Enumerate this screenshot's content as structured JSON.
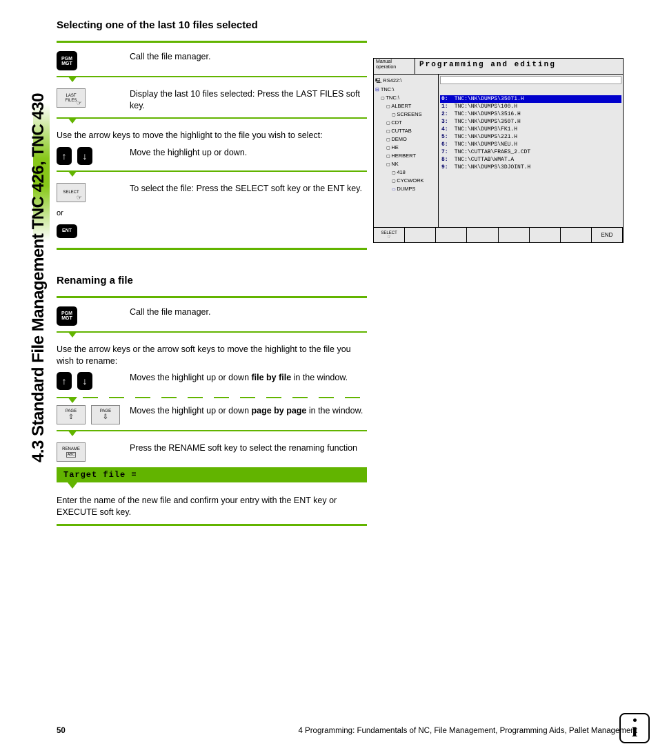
{
  "sideTitle": "4.3 Standard File Management TNC 426, TNC 430",
  "section1": {
    "heading": "Selecting one of the last 10 files selected",
    "step1": {
      "desc": "Call the file manager."
    },
    "step2": {
      "desc": "Display the last 10 files selected: Press the LAST FILES soft key."
    },
    "intro": "Use the arrow keys to move the highlight to the file you wish to select:",
    "step3": {
      "desc": "Move the highlight up or down."
    },
    "step4": {
      "desc": "To select the file: Press the SELECT soft key or the ENT key."
    },
    "or": "or"
  },
  "section2": {
    "heading": "Renaming a file",
    "step1": {
      "desc": "Call the file manager."
    },
    "intro": "Use the arrow keys or the arrow soft keys to move the highlight to the file you wish to rename:",
    "step2": {
      "pre": "Moves the highlight up or down ",
      "bold": "file by file",
      "post": " in the window."
    },
    "step3": {
      "pre": "Moves the highlight up or down ",
      "bold": "page by page",
      "post": " in the window."
    },
    "step4": {
      "desc": "Press the RENAME soft key to select the renaming function"
    },
    "target": "Target file =",
    "final": "Enter the name of the new file and confirm your entry with the ENT key or EXECUTE soft key."
  },
  "keys": {
    "pgm1": "PGM",
    "pgm2": "MGT",
    "lastfiles": "LAST FILES",
    "select": "SELECT",
    "ent": "ENT",
    "page": "PAGE",
    "rename": "RENAME",
    "renameSub": "ABC = XYZ"
  },
  "screenshot": {
    "mode": "Manual operation",
    "title": "Programming and editing",
    "tree": [
      {
        "cls": "disk",
        "txt": "RS422:\\",
        "ind": ""
      },
      {
        "cls": "drv",
        "txt": "TNC:\\",
        "ind": ""
      },
      {
        "cls": "fold",
        "txt": "TNC:\\",
        "ind": "ind1"
      },
      {
        "cls": "fold",
        "txt": "ALBERT",
        "ind": "ind2"
      },
      {
        "cls": "fold",
        "txt": "SCREENS",
        "ind": "ind3"
      },
      {
        "cls": "fold",
        "txt": "CDT",
        "ind": "ind2"
      },
      {
        "cls": "fold",
        "txt": "CUTTAB",
        "ind": "ind2"
      },
      {
        "cls": "fold",
        "txt": "DEMO",
        "ind": "ind2"
      },
      {
        "cls": "fold",
        "txt": "HE",
        "ind": "ind2"
      },
      {
        "cls": "fold",
        "txt": "HERBERT",
        "ind": "ind2"
      },
      {
        "cls": "fold",
        "txt": "NK",
        "ind": "ind2"
      },
      {
        "cls": "fold",
        "txt": "418",
        "ind": "ind3"
      },
      {
        "cls": "fold",
        "txt": "CYCWORK",
        "ind": "ind3"
      },
      {
        "cls": "open",
        "txt": "DUMPS",
        "ind": "ind3"
      }
    ],
    "files": [
      {
        "n": "0:",
        "t": "TNC:\\NK\\DUMPS\\35071.H",
        "sel": true
      },
      {
        "n": "1:",
        "t": "TNC:\\NK\\DUMPS\\100.H"
      },
      {
        "n": "2:",
        "t": "TNC:\\NK\\DUMPS\\3516.H"
      },
      {
        "n": "3:",
        "t": "TNC:\\NK\\DUMPS\\3507.H"
      },
      {
        "n": "4:",
        "t": "TNC:\\NK\\DUMPS\\FK1.H"
      },
      {
        "n": "5:",
        "t": "TNC:\\NK\\DUMPS\\221.H"
      },
      {
        "n": "6:",
        "t": "TNC:\\NK\\DUMPS\\NEU.H"
      },
      {
        "n": "7:",
        "t": "TNC:\\CUTTAB\\FRAES_2.CDT"
      },
      {
        "n": "8:",
        "t": "TNC:\\CUTTAB\\WMAT.A"
      },
      {
        "n": "9:",
        "t": "TNC:\\NK\\DUMPS\\3DJOINT.H"
      }
    ],
    "softkeys": {
      "select": "SELECT",
      "end": "END"
    }
  },
  "footer": {
    "page": "50",
    "chapter": "4 Programming: Fundamentals of NC, File Management, Programming Aids, Pallet Management"
  }
}
